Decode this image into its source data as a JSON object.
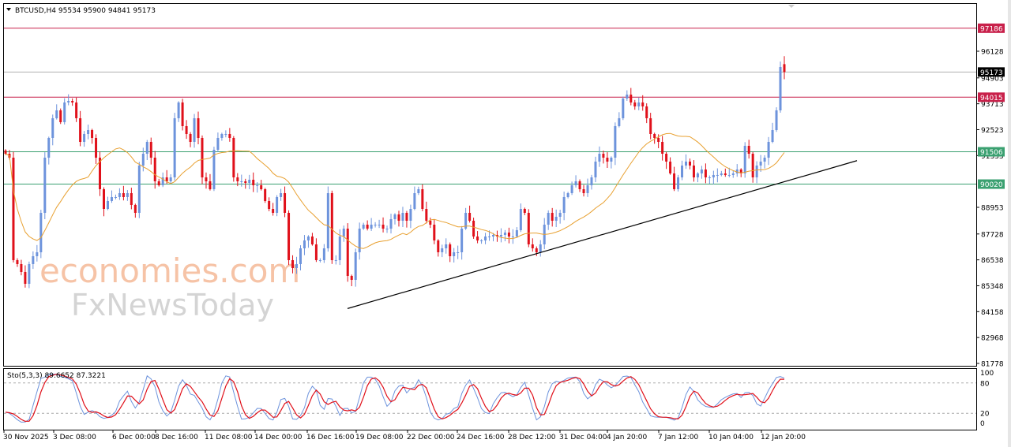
{
  "header": {
    "symbol_line": "BTCUSD,H4  95534 95900 94841 95173"
  },
  "watermark": {
    "line1": "economies.com",
    "line2": "FxNewsToday"
  },
  "colors": {
    "bull": "#6d93dc",
    "bear": "#e0101a",
    "ma": "#e8a030",
    "resistance": "#c8204a",
    "support": "#3aa070",
    "current": "#b0b0b0",
    "stoch_main": "#6d93dc",
    "stoch_signal": "#e0101a"
  },
  "chart_data": {
    "type": "candlestick",
    "symbol": "BTCUSD",
    "timeframe": "H4",
    "last_ohlc": {
      "open": 95534,
      "high": 95900,
      "low": 94841,
      "close": 95173
    },
    "closes_approx": [
      91417,
      91236,
      86525,
      86344,
      85981,
      85438,
      86344,
      86706,
      86887,
      88699,
      91236,
      92142,
      93048,
      93410,
      92867,
      93773,
      93845,
      93773,
      93048,
      91961,
      92323,
      92504,
      92142,
      91236,
      89786,
      88880,
      89243,
      89424,
      89424,
      89605,
      89424,
      89605,
      89062,
      88699,
      90874,
      91417,
      91961,
      91236,
      90149,
      89968,
      90330,
      90149,
      90330,
      93048,
      93773,
      92686,
      92323,
      91961,
      93048,
      92142,
      90330,
      90149,
      89786,
      91598,
      92142,
      92323,
      92323,
      92142,
      90330,
      90149,
      90149,
      90076,
      90221,
      89968,
      89968,
      89786,
      89243,
      88880,
      88699,
      89424,
      89605,
      88699,
      86525,
      86162,
      86344,
      87068,
      87431,
      87612,
      87250,
      86525,
      86525,
      87068,
      89605,
      86525,
      86525,
      87612,
      87974,
      85800,
      85619,
      86887,
      87974,
      88156,
      87974,
      88156,
      88156,
      88156,
      87974,
      87974,
      88409,
      88627,
      88337,
      88699,
      88337,
      88880,
      89605,
      89786,
      88880,
      88337,
      88156,
      87431,
      86887,
      87068,
      87250,
      86706,
      86887,
      86887,
      87974,
      88699,
      88337,
      87612,
      87431,
      87431,
      87612,
      87612,
      87684,
      87612,
      87684,
      87793,
      87612,
      87612,
      87902,
      88880,
      88699,
      87250,
      87068,
      86887,
      87250,
      88156,
      88699,
      88337,
      88518,
      88699,
      89424,
      89605,
      89968,
      90149,
      89786,
      89605,
      89968,
      90330,
      91055,
      91417,
      91236,
      91055,
      91236,
      92686,
      93048,
      93954,
      94135,
      93773,
      93592,
      93773,
      93592,
      93048,
      92323,
      92142,
      91961,
      91417,
      91055,
      90511,
      89786,
      90330,
      90874,
      91055,
      90874,
      90330,
      90511,
      90692,
      90330,
      90330,
      90439,
      90439,
      90511,
      90439,
      90439,
      90511,
      90692,
      90511,
      91780,
      91417,
      90330,
      90874,
      91055,
      91236,
      91961,
      92504,
      93410,
      95404,
      95173
    ],
    "price_axis": {
      "ticks": [
        "96128",
        "94903",
        "93713",
        "92523",
        "91333",
        "88953",
        "87728",
        "86538",
        "85348",
        "84158",
        "82968",
        "81778"
      ],
      "range": [
        81778,
        97700
      ]
    },
    "levels": [
      {
        "price": 97186,
        "label": "97186",
        "kind": "resistance"
      },
      {
        "price": 94015,
        "label": "94015",
        "kind": "resistance"
      },
      {
        "price": 91506,
        "label": "91506",
        "kind": "support"
      },
      {
        "price": 90020,
        "label": "90020",
        "kind": "support"
      }
    ],
    "current_price": {
      "price": 95173,
      "label": "95173"
    },
    "trendline": {
      "from": {
        "time": "17 Dec 2025",
        "price": 84300
      },
      "to": {
        "time": "14 Jan 2026",
        "price": 91100
      }
    },
    "moving_average": true,
    "x_axis": {
      "ticks": [
        "30 Nov 2025",
        "3 Dec 08:00",
        "6 Dec 00:00",
        "8 Dec 16:00",
        "11 Dec 08:00",
        "14 Dec 00:00",
        "16 Dec 16:00",
        "19 Dec 08:00",
        "22 Dec 00:00",
        "24 Dec 16:00",
        "28 Dec 12:00",
        "31 Dec 04:00",
        "4 Jan 20:00",
        "7 Jan 12:00",
        "10 Jan 04:00",
        "12 Jan 20:00"
      ]
    },
    "stochastic": {
      "label": "Sto(5,3,3) 89.6652 87.3221",
      "main": 89.6652,
      "signal": 87.3221,
      "levels": [
        "100",
        "80",
        "20",
        "0"
      ],
      "range": [
        0,
        100
      ]
    }
  }
}
